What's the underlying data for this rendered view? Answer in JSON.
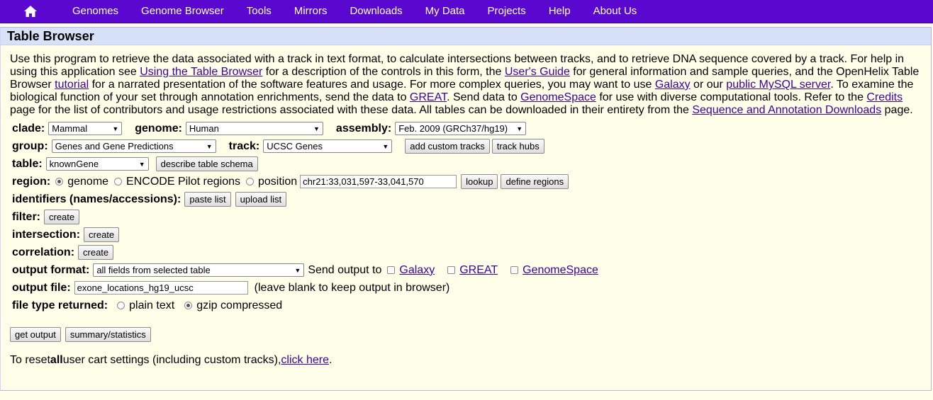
{
  "nav": {
    "items": [
      "Genomes",
      "Genome Browser",
      "Tools",
      "Mirrors",
      "Downloads",
      "My Data",
      "Projects",
      "Help",
      "About Us"
    ],
    "home_icon": "home-icon"
  },
  "panel": {
    "title": "Table Browser"
  },
  "intro": {
    "t1": "Use this program to retrieve the data associated with a track in text format, to calculate intersections between tracks, and to retrieve DNA sequence covered by a track. For help in using this application see ",
    "l1": "Using the Table Browser",
    "t2": " for a description of the controls in this form, the ",
    "l2": "User's Guide",
    "t3": " for general information and sample queries, and the OpenHelix Table Browser ",
    "l3": "tutorial",
    "t4": " for a narrated presentation of the software features and usage. For more complex queries, you may want to use ",
    "l4": "Galaxy",
    "t5": " or our ",
    "l5": "public MySQL server",
    "t6": ". To examine the biological function of your set through annotation enrichments, send the data to ",
    "l6": "GREAT",
    "t7": ". Send data to ",
    "l7": "GenomeSpace",
    "t8": " for use with diverse computational tools. Refer to the ",
    "l8": "Credits",
    "t9": " page for the list of contributors and usage restrictions associated with these data. All tables can be downloaded in their entirety from the ",
    "l9": "Sequence and Annotation Downloads",
    "t10": " page."
  },
  "form": {
    "clade_label": "clade:",
    "clade_value": "Mammal",
    "genome_label": "genome:",
    "genome_value": "Human",
    "assembly_label": "assembly:",
    "assembly_value": "Feb. 2009 (GRCh37/hg19)",
    "group_label": "group:",
    "group_value": "Genes and Gene Predictions",
    "track_label": "track:",
    "track_value": "UCSC Genes",
    "add_custom_tracks": "add custom tracks",
    "track_hubs": "track hubs",
    "table_label": "table:",
    "table_value": "knownGene",
    "describe_schema": "describe table schema",
    "region_label": "region:",
    "region_genome": "genome",
    "region_encode": "ENCODE Pilot regions",
    "region_position": "position",
    "position_value": "chr21:33,031,597-33,041,570",
    "lookup": "lookup",
    "define_regions": "define regions",
    "identifiers_label": "identifiers (names/accessions):",
    "paste_list": "paste list",
    "upload_list": "upload list",
    "filter_label": "filter:",
    "intersection_label": "intersection:",
    "correlation_label": "correlation:",
    "create": "create",
    "output_format_label": "output format:",
    "output_format_value": "all fields from selected table",
    "send_output_to": "Send output to",
    "send_galaxy": "Galaxy",
    "send_great": "GREAT",
    "send_genomespace": "GenomeSpace",
    "output_file_label": "output file:",
    "output_file_value": "exone_locations_hg19_ucsc",
    "output_file_hint": "(leave blank to keep output in browser)",
    "file_type_label": "file type returned:",
    "plain_text": "plain text",
    "gzip": "gzip compressed",
    "get_output": "get output",
    "summary_statistics": "summary/statistics",
    "reset_t1": "To reset ",
    "reset_bold": "all",
    "reset_t2": " user cart settings (including custom tracks), ",
    "reset_link": "click here",
    "reset_t3": "."
  }
}
